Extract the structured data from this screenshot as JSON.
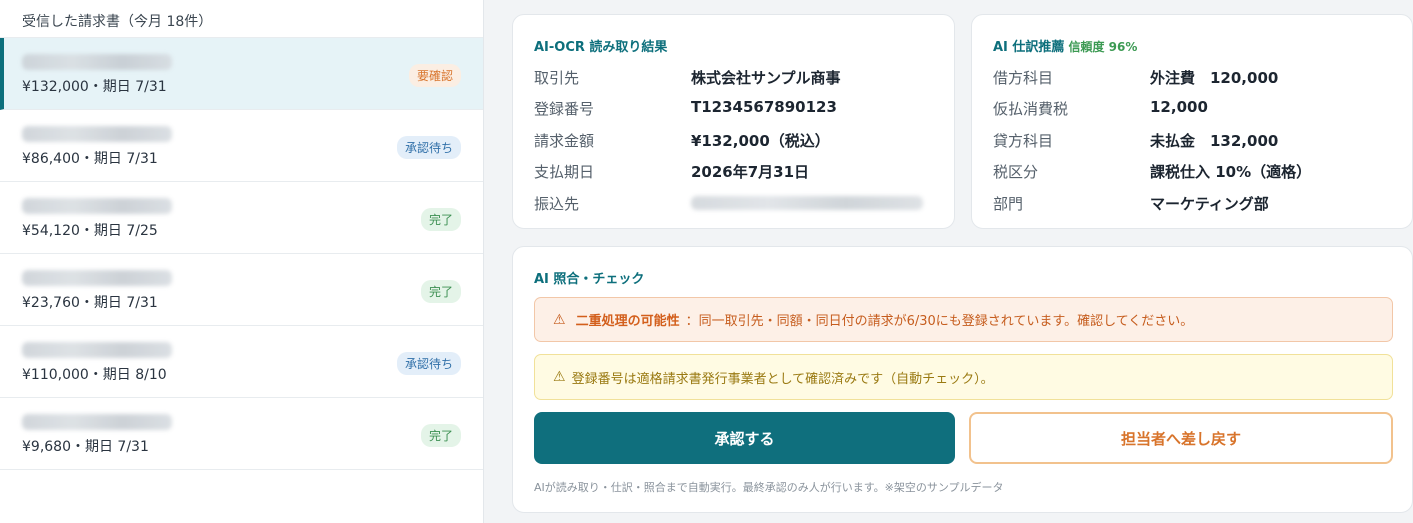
{
  "list": {
    "header": "受信した請求書（今月 18件）",
    "items": [
      {
        "sub": "¥132,000・期日 7/31",
        "status": "要確認"
      },
      {
        "sub": "¥86,400・期日 7/31",
        "status": "承認待ち"
      },
      {
        "sub": "¥54,120・期日 7/25",
        "status": "完了"
      },
      {
        "sub": "¥23,760・期日 7/31",
        "status": "完了"
      },
      {
        "sub": "¥110,000・期日 8/10",
        "status": "承認待ち"
      },
      {
        "sub": "¥9,680・期日 7/31",
        "status": "完了"
      }
    ]
  },
  "ocr": {
    "title": "AI-OCR 読み取り結果",
    "rows": [
      {
        "label": "取引先",
        "value": "株式会社サンプル商事"
      },
      {
        "label": "登録番号",
        "value": "T1234567890123"
      },
      {
        "label": "請求金額",
        "value": "¥132,000（税込）"
      },
      {
        "label": "支払期日",
        "value": "2026年7月31日"
      },
      {
        "label": "振込先",
        "value": ""
      }
    ]
  },
  "journal": {
    "title": "AI 仕訳推薦",
    "confidence": "信頼度 96%",
    "rows": [
      {
        "label": "借方科目",
        "value": "外注費　120,000"
      },
      {
        "label": "仮払消費税",
        "value": "12,000"
      },
      {
        "label": "貸方科目",
        "value": "未払金　132,000"
      },
      {
        "label": "税区分",
        "value": "課税仕入 10%（適格）"
      },
      {
        "label": "部門",
        "value": "マーケティング部"
      }
    ]
  },
  "check": {
    "title": "AI 照合・チェック",
    "warning_icon": "⚠",
    "duplicate_strong": "二重処理の可能性",
    "duplicate_text": "：同一取引先・同額・同日付の請求が6/30にも登録されています。確認してください。",
    "registration_text": "登録番号は適格請求書発行事業者として確認済みです（自動チェック）。",
    "approve_label": "承認する",
    "return_label": "担当者へ差し戻す",
    "footnote": "AIが読み取り・仕訳・照合まで自動実行。最終承認のみ人が行います。※架空のサンプルデータ"
  }
}
